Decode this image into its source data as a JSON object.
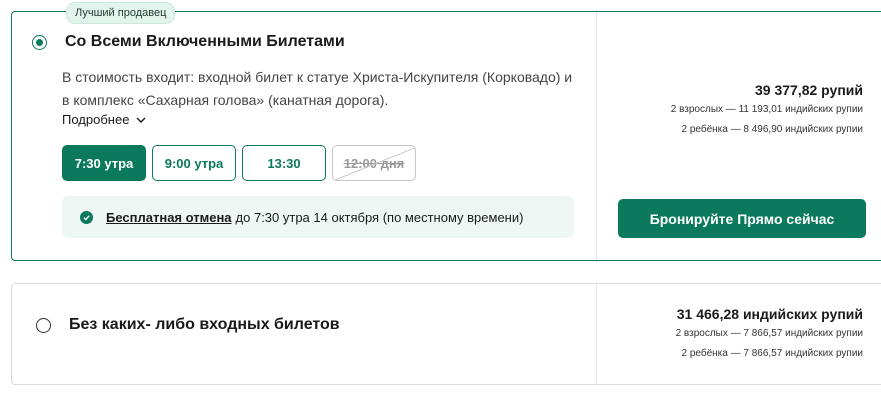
{
  "options": [
    {
      "badge": "Лучший продавец",
      "title": "Со Всеми Включенными Билетами",
      "description": "В стоимость входит: входной билет к статуе Христа-Искупителя (Корковадо) и в комплекс «Сахарная голова» (канатная дорога).",
      "more_label": "Подробнее",
      "times": [
        {
          "label": "7:30 утра",
          "state": "selected"
        },
        {
          "label": "9:00 утра",
          "state": "available"
        },
        {
          "label": "13:30",
          "state": "available"
        },
        {
          "label": "12:00 дня",
          "state": "unavailable"
        }
      ],
      "cancellation": {
        "link_text": "Бесплатная отмена",
        "details": "до 7:30 утра 14 октября (по местному времени)"
      },
      "price": {
        "total": "39 377,82 рупий",
        "adults": "2 взрослых — 11 193,01 индийских рупии",
        "children": "2 ребёнка — 8 496,90 индийских рупии"
      },
      "book_label": "Бронируйте Прямо сейчас",
      "selected": true
    },
    {
      "title": "Без каких- либо входных билетов",
      "price": {
        "total": "31 466,28 индийских рупий",
        "adults": "2 взрослых — 7 866,57 индийских рупии",
        "children": "2 ребёнка — 7 866,57 индийских рупии"
      },
      "selected": false
    }
  ],
  "colors": {
    "accent": "#0b7a5c",
    "badge_bg": "#e3f4ec",
    "cancel_bg": "#eef7f3"
  }
}
